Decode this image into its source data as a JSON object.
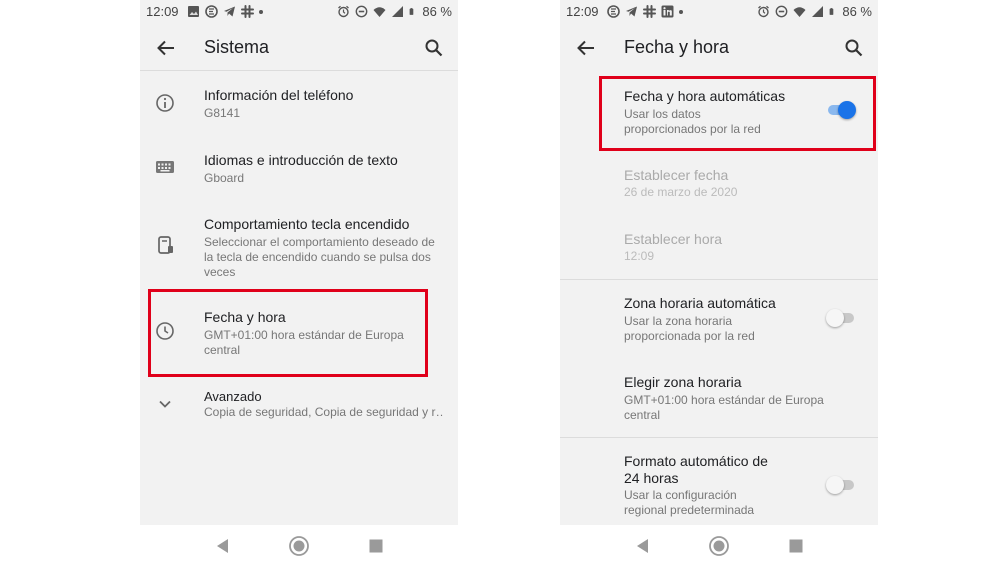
{
  "status_bar": {
    "time": "12:09",
    "battery": "86 %"
  },
  "left": {
    "title": "Sistema",
    "items": [
      {
        "title": "Información del teléfono",
        "sub": "G8141",
        "icon": "info-icon"
      },
      {
        "title": "Idiomas e introducción de texto",
        "sub": "Gboard",
        "icon": "keyboard-icon"
      },
      {
        "title": "Comportamiento tecla encendido",
        "sub": "Seleccionar el comportamiento deseado de la tecla de encendido cuando se pulsa dos veces",
        "icon": "power-key-icon"
      },
      {
        "title": "Fecha y hora",
        "sub": "GMT+01:00 hora estándar de Europa central",
        "icon": "clock-icon"
      },
      {
        "title": "Avanzado",
        "sub": "Copia de seguridad, Copia de seguridad y r…",
        "icon": "chevron-down-icon"
      }
    ]
  },
  "right": {
    "title": "Fecha y hora",
    "items": [
      {
        "title": "Fecha y hora automáticas",
        "sub": "Usar los datos proporcionados por la red",
        "toggle": true
      },
      {
        "title": "Establecer fecha",
        "sub": "26 de marzo de 2020",
        "disabled": true
      },
      {
        "title": "Establecer hora",
        "sub": "12:09",
        "disabled": true
      },
      {
        "title": "Zona horaria automática",
        "sub": "Usar la zona horaria proporcionada por la red",
        "toggle": false
      },
      {
        "title": "Elegir zona horaria",
        "sub": "GMT+01:00 hora estándar de Europa central"
      },
      {
        "title": "Formato automático de 24 horas",
        "sub": "Usar la configuración regional predeterminada",
        "toggle": false
      }
    ]
  },
  "colors": {
    "accent": "#1a73e8",
    "highlight": "#e0001a"
  }
}
